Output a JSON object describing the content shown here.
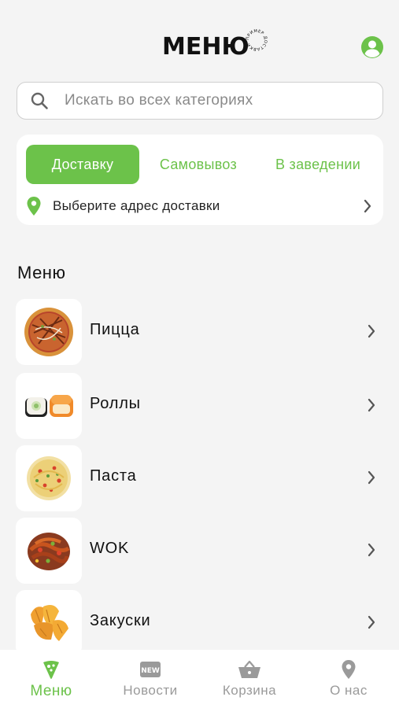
{
  "header": {
    "logo_text": "МЕНЮ",
    "logo_ring_text": "ПРИМЕР ДОСТАВКИ"
  },
  "search": {
    "placeholder": "Искать во всех категориях"
  },
  "order_modes": {
    "tabs": [
      {
        "label": "Доставку",
        "active": true
      },
      {
        "label": "Самовывоз",
        "active": false
      },
      {
        "label": "В заведении",
        "active": false
      }
    ],
    "address_prompt": "Выберите адрес доставки"
  },
  "menu": {
    "title": "Меню",
    "items": [
      {
        "label": "Пицца",
        "image": "pizza"
      },
      {
        "label": "Роллы",
        "image": "rolls"
      },
      {
        "label": "Паста",
        "image": "pasta"
      },
      {
        "label": "WOK",
        "image": "wok"
      },
      {
        "label": "Закуски",
        "image": "snacks"
      }
    ]
  },
  "bottom_nav": {
    "items": [
      {
        "label": "Меню",
        "icon": "menu-leaf-icon",
        "active": true
      },
      {
        "label": "Новости",
        "icon": "news-badge-icon",
        "active": false
      },
      {
        "label": "Корзина",
        "icon": "basket-icon",
        "active": false
      },
      {
        "label": "О нас",
        "icon": "location-pin-icon",
        "active": false
      }
    ],
    "badge_text": "NEW"
  },
  "colors": {
    "accent": "#6cc24a",
    "background": "#f4f4f4",
    "inactive": "#9a9a9a"
  }
}
